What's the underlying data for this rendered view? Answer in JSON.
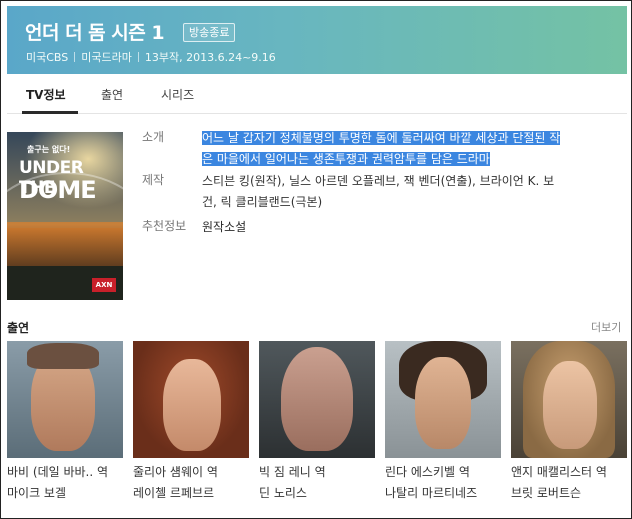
{
  "header": {
    "title": "언더 더 돔 시즌 1",
    "badge": "방송종료",
    "meta": [
      "미국CBS",
      "미국드라마",
      "13부작, 2013.6.24~9.16"
    ],
    "colors": {
      "gradient_start": "#5aa7c9",
      "gradient_end": "#74c2a4"
    }
  },
  "tabs": [
    {
      "label": "TV정보",
      "active": true
    },
    {
      "label": "출연",
      "active": false
    },
    {
      "label": "시리즈",
      "active": false
    }
  ],
  "poster": {
    "tagline": "출구는 없다!",
    "title_line1": "UNDER THE",
    "title_line2": "DOME",
    "channel_logo": "AXN"
  },
  "info": {
    "intro_label": "소개",
    "intro_line1": "어느 날 갑자기 정체불명의 투명한 돔에 둘러싸여 바깥 세상과 단절된 작",
    "intro_line2": "은 마을에서 일어나는 생존투쟁과 권력암투를 담은 드라마",
    "production_label": "제작",
    "production_line1": "스티븐 킹(원작), 닐스 아르덴 오플레브, 잭 벤더(연출), 브라이언 K. 보",
    "production_line2": "건, 릭 클리블랜드(극본)",
    "recommend_label": "추천정보",
    "recommend_value": "원작소설"
  },
  "cast_section": {
    "title": "출연",
    "more_label": "더보기",
    "members": [
      {
        "line1": "바비 (데일 바바.. 역",
        "line2": "마이크 보겔"
      },
      {
        "line1": "줄리아 섐웨이 역",
        "line2": "레이첼 르페브르"
      },
      {
        "line1": "빅 짐 레니 역",
        "line2": "딘 노리스"
      },
      {
        "line1": "린다 에스키벨 역",
        "line2": "나탈리 마르티네즈"
      },
      {
        "line1": "앤지 매캘리스터 역",
        "line2": "브릿 로버트슨"
      }
    ]
  }
}
